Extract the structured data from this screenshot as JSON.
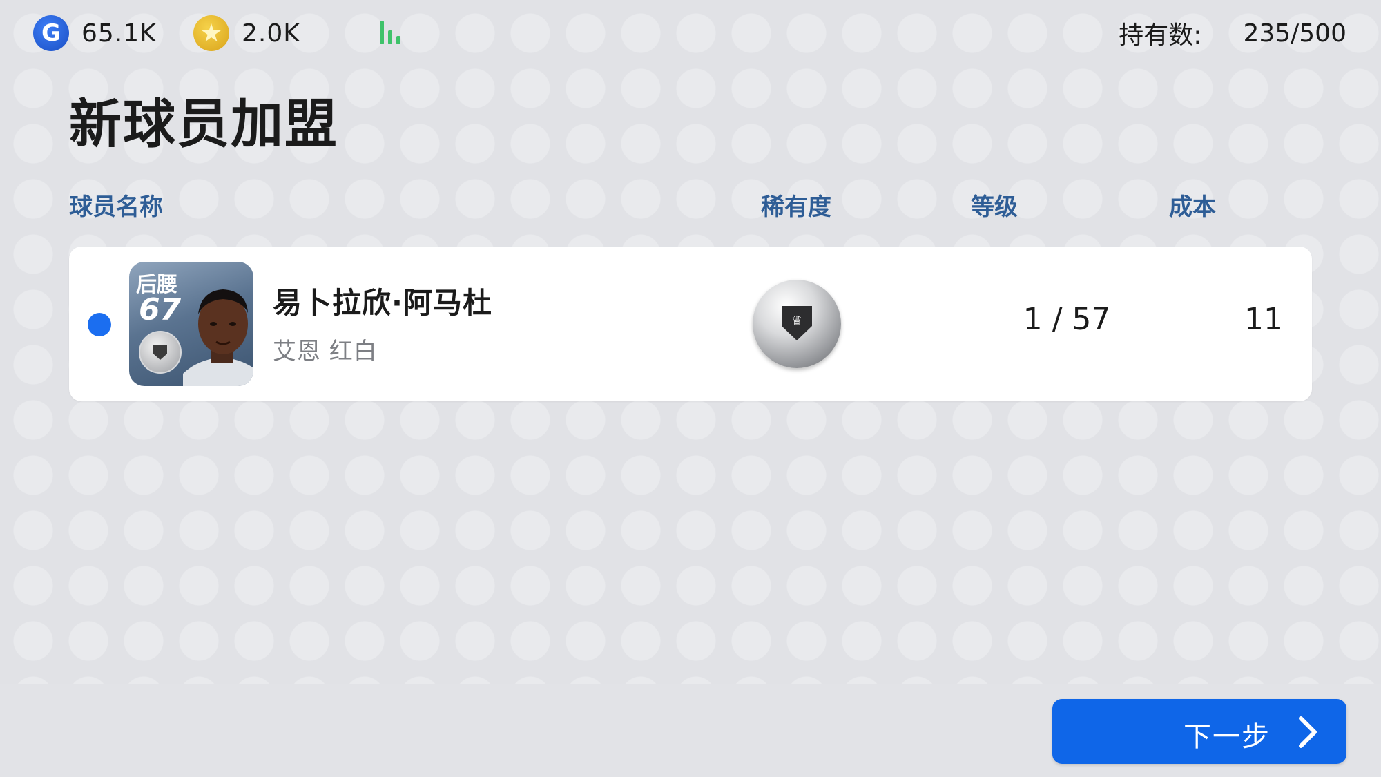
{
  "header": {
    "currency_g": {
      "icon": "g-coin-icon",
      "value": "65.1K"
    },
    "currency_star": {
      "icon": "star-coin-icon",
      "value": "2.0K"
    },
    "signal_icon": "signal-bars-icon",
    "holdings": {
      "label": "持有数:",
      "value": "235/500"
    }
  },
  "page": {
    "title": "新球员加盟"
  },
  "table": {
    "headers": {
      "name": "球员名称",
      "rarity": "稀有度",
      "level": "等级",
      "cost": "成本"
    },
    "rows": [
      {
        "position": "后腰",
        "rating": "67",
        "name": "易卜拉欣·阿马杜",
        "team": "艾恩 红白",
        "rarity_icon": "silver-ball-icon",
        "level": "1 / 57",
        "cost": "11"
      }
    ]
  },
  "footer": {
    "next_label": "下一步"
  },
  "colors": {
    "accent": "#0f66e8",
    "header_text": "#2e5d96",
    "selection_dot": "#1b6ef0",
    "signal": "#3ec26a"
  }
}
